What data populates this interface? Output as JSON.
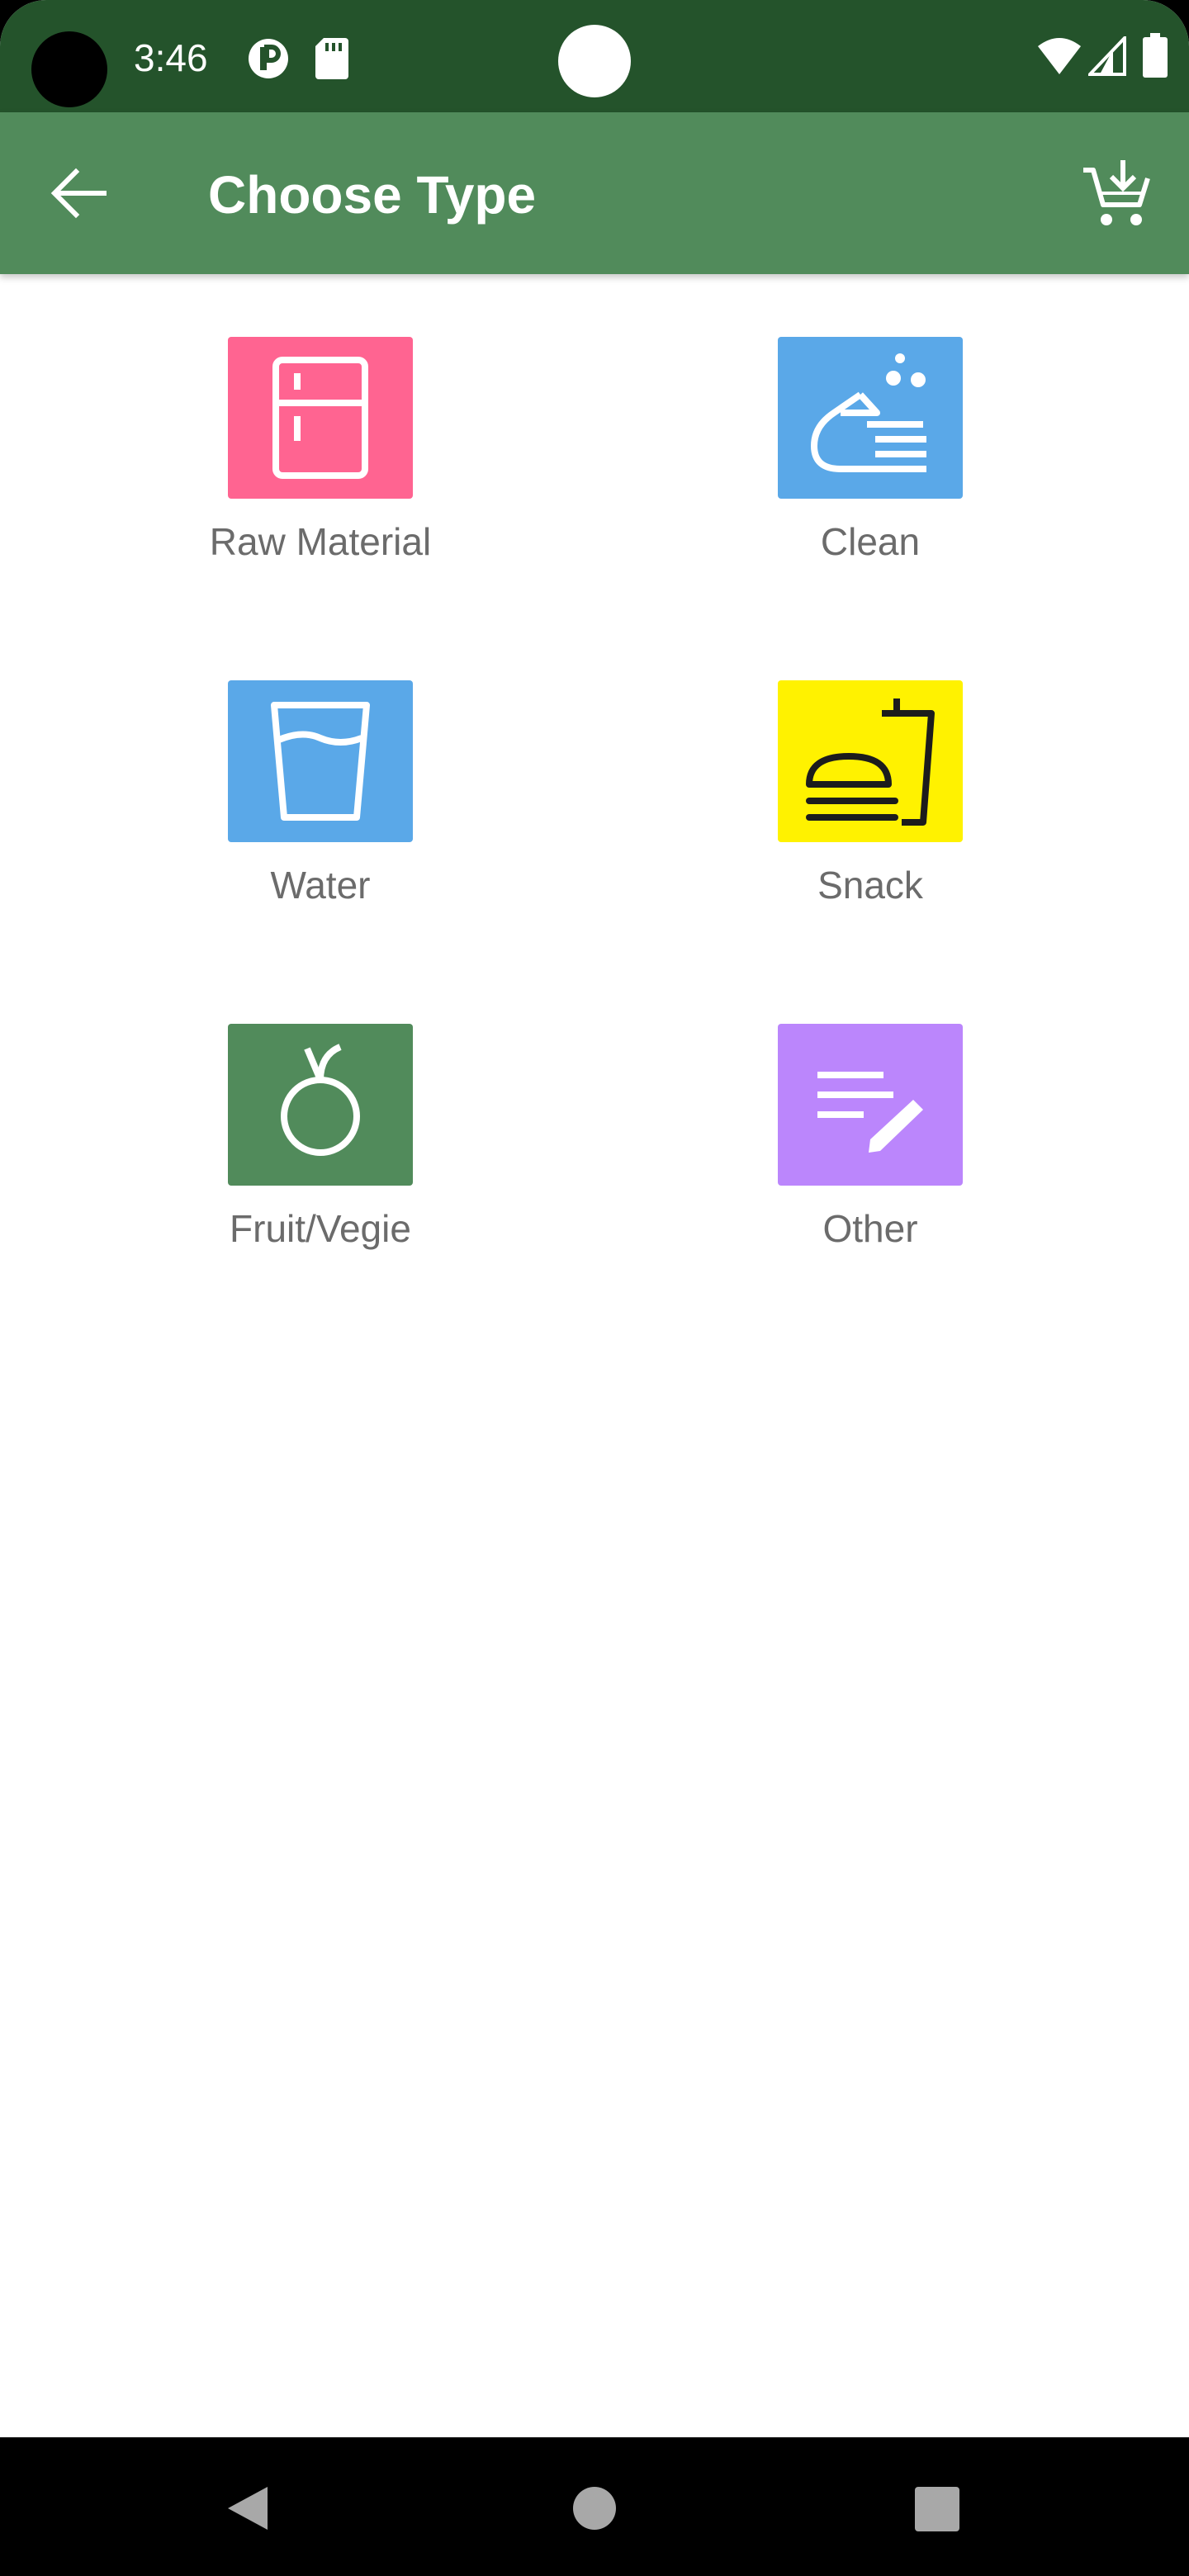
{
  "status_bar": {
    "time": "3:46",
    "icons": [
      "camera-cutout",
      "notification-p-icon",
      "sd-card-icon",
      "wifi-icon",
      "signal-icon",
      "battery-icon"
    ],
    "background": "#24532b"
  },
  "app_bar": {
    "title": "Choose Type",
    "background": "#518b5b",
    "back_icon": "arrow-back-icon",
    "action_icon": "add-shopping-cart-icon"
  },
  "types": [
    {
      "label": "Raw Material",
      "icon": "fridge-icon",
      "color": "#ff6491"
    },
    {
      "label": "Clean",
      "icon": "hand-wash-icon",
      "color": "#5aa8e8"
    },
    {
      "label": "Water",
      "icon": "water-glass-icon",
      "color": "#5aa8e8"
    },
    {
      "label": "Snack",
      "icon": "fastfood-icon",
      "color": "#fff200"
    },
    {
      "label": "Fruit/Vegie",
      "icon": "fruit-icon",
      "color": "#518b5b"
    },
    {
      "label": "Other",
      "icon": "edit-note-icon",
      "color": "#bb86fc"
    }
  ],
  "nav_bar": {
    "buttons": [
      "nav-back-icon",
      "nav-home-icon",
      "nav-recents-icon"
    ]
  }
}
